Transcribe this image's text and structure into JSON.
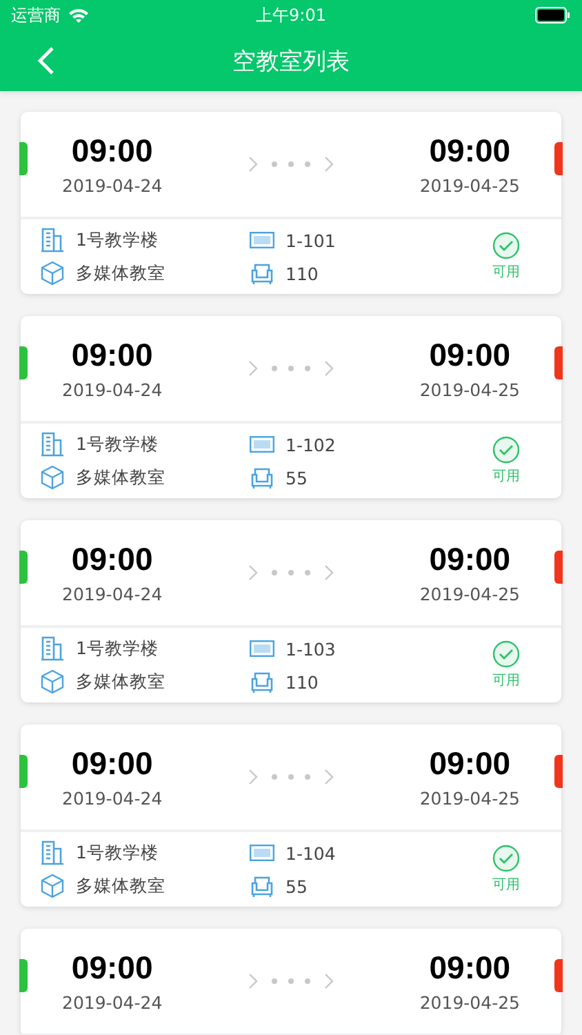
{
  "status_bar": {
    "carrier": "运营商",
    "time": "上午9:01"
  },
  "nav": {
    "title": "空教室列表"
  },
  "rooms": [
    {
      "start_time": "09:00",
      "start_date": "2019-04-24",
      "end_time": "09:00",
      "end_date": "2019-04-25",
      "building": "1号教学楼",
      "room_no": "1-101",
      "room_type": "多媒体教室",
      "seats": "110",
      "status": "可用"
    },
    {
      "start_time": "09:00",
      "start_date": "2019-04-24",
      "end_time": "09:00",
      "end_date": "2019-04-25",
      "building": "1号教学楼",
      "room_no": "1-102",
      "room_type": "多媒体教室",
      "seats": "55",
      "status": "可用"
    },
    {
      "start_time": "09:00",
      "start_date": "2019-04-24",
      "end_time": "09:00",
      "end_date": "2019-04-25",
      "building": "1号教学楼",
      "room_no": "1-103",
      "room_type": "多媒体教室",
      "seats": "110",
      "status": "可用"
    },
    {
      "start_time": "09:00",
      "start_date": "2019-04-24",
      "end_time": "09:00",
      "end_date": "2019-04-25",
      "building": "1号教学楼",
      "room_no": "1-104",
      "room_type": "多媒体教室",
      "seats": "55",
      "status": "可用"
    },
    {
      "start_time": "09:00",
      "start_date": "2019-04-24",
      "end_time": "09:00",
      "end_date": "2019-04-25"
    }
  ]
}
